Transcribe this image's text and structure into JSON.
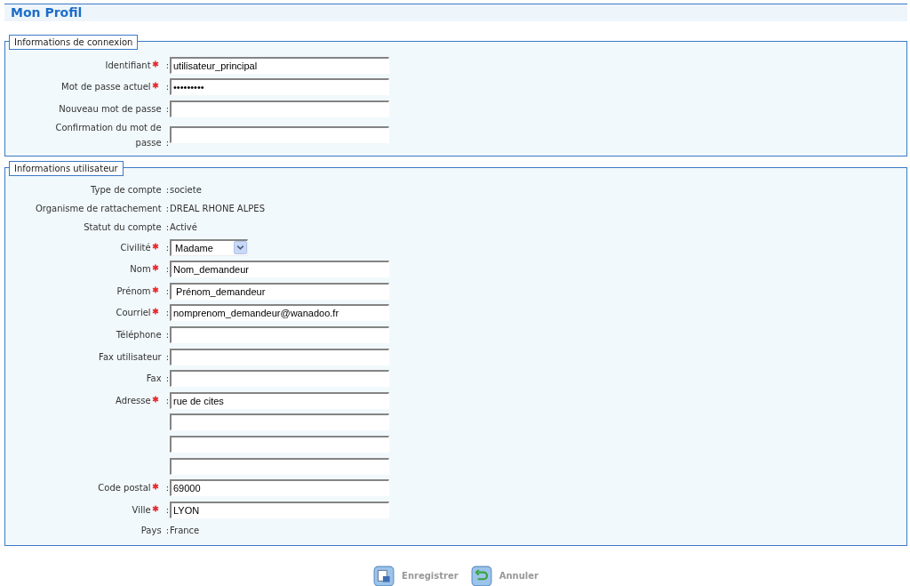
{
  "page_title": "Mon Profil",
  "sections": [
    {
      "legend": "Informations de connexion",
      "rows": [
        {
          "kind": "input",
          "label": "Identifiant",
          "required": true,
          "separator": ":",
          "value": "utilisateur_principal"
        },
        {
          "kind": "input",
          "label": "Mot de passe actuel",
          "required": true,
          "separator": ":",
          "value": "•••••••••"
        },
        {
          "kind": "input",
          "label": "Nouveau mot de passe",
          "required": false,
          "separator": ":",
          "value": ""
        },
        {
          "kind": "input",
          "label": "Confirmation du mot de passe",
          "required": false,
          "separator": ":",
          "value": ""
        }
      ]
    },
    {
      "legend": "Informations utilisateur",
      "rows": [
        {
          "kind": "static",
          "label": "Type de compte",
          "required": false,
          "separator": ":",
          "value": "societe"
        },
        {
          "kind": "static",
          "label": "Organisme de rattachement",
          "required": false,
          "separator": ":",
          "value": "DREAL RHONE ALPES"
        },
        {
          "kind": "static",
          "label": "Statut du compte",
          "required": false,
          "separator": ":",
          "value": "Activé"
        },
        {
          "kind": "select",
          "label": "Civilité",
          "required": true,
          "separator": ":",
          "value": "Madame"
        },
        {
          "kind": "input",
          "label": "Nom",
          "required": true,
          "separator": ":",
          "value": "Nom_demandeur"
        },
        {
          "kind": "input",
          "label": "Prénom",
          "required": true,
          "separator": ":",
          "value": " Prénom_demandeur"
        },
        {
          "kind": "input",
          "label": "Courriel",
          "required": true,
          "separator": ":",
          "value": "nomprenom_demandeur@wanadoo.fr"
        },
        {
          "kind": "input",
          "label": "Téléphone",
          "required": false,
          "separator": ":",
          "value": ""
        },
        {
          "kind": "input",
          "label": "Fax utilisateur",
          "required": false,
          "separator": ":",
          "value": ""
        },
        {
          "kind": "input",
          "label": "Fax",
          "required": false,
          "separator": ":",
          "value": ""
        },
        {
          "kind": "input",
          "label": "Adresse",
          "required": true,
          "separator": ":",
          "value": "rue de cites"
        },
        {
          "kind": "input",
          "value": ""
        },
        {
          "kind": "input",
          "value": ""
        },
        {
          "kind": "input",
          "value": ""
        },
        {
          "kind": "input",
          "label": "Code postal",
          "required": true,
          "separator": ":",
          "value": "69000"
        },
        {
          "kind": "input",
          "label": "Ville",
          "required": true,
          "separator": ":",
          "value": "LYON"
        },
        {
          "kind": "static",
          "label": "Pays",
          "required": false,
          "separator": ":",
          "value": "France"
        }
      ]
    }
  ],
  "buttons": [
    {
      "kind": "save",
      "label": "Enregistrer"
    },
    {
      "kind": "cancel",
      "label": "Annuler"
    }
  ]
}
